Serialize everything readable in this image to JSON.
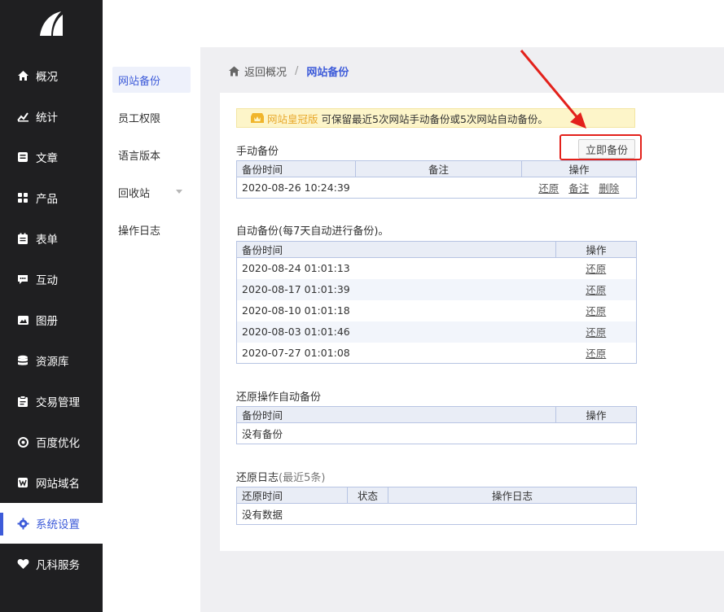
{
  "sidebar": {
    "items": [
      {
        "label": "概况",
        "icon": "home-icon"
      },
      {
        "label": "统计",
        "icon": "stats-icon"
      },
      {
        "label": "文章",
        "icon": "article-icon"
      },
      {
        "label": "产品",
        "icon": "product-icon"
      },
      {
        "label": "表单",
        "icon": "form-icon"
      },
      {
        "label": "互动",
        "icon": "chat-icon"
      },
      {
        "label": "图册",
        "icon": "gallery-icon"
      },
      {
        "label": "资源库",
        "icon": "database-icon"
      },
      {
        "label": "交易管理",
        "icon": "trade-icon"
      },
      {
        "label": "百度优化",
        "icon": "seo-icon"
      },
      {
        "label": "网站域名",
        "icon": "domain-icon"
      },
      {
        "label": "系统设置",
        "icon": "gear-icon"
      },
      {
        "label": "凡科服务",
        "icon": "heart-icon"
      }
    ]
  },
  "submenu": {
    "items": [
      "网站备份",
      "员工权限",
      "语言版本",
      "回收站",
      "操作日志"
    ]
  },
  "breadcrumb": {
    "back": "返回概况",
    "separator": "/",
    "current": "网站备份"
  },
  "notice": {
    "tag": "网站皇冠版",
    "text": "可保留最近5次网站手动备份或5次网站自动备份。"
  },
  "manual": {
    "title": "手动备份",
    "button": "立即备份",
    "headers": [
      "备份时间",
      "备注",
      "操作"
    ],
    "rows": [
      {
        "time": "2020-08-26 10:24:39",
        "note": "",
        "ops": [
          "还原",
          "备注",
          "删除"
        ]
      }
    ]
  },
  "auto": {
    "title": "自动备份(每7天自动进行备份)。",
    "headers": [
      "备份时间",
      "操作"
    ],
    "op": "还原",
    "rows": [
      "2020-08-24 01:01:13",
      "2020-08-17 01:01:39",
      "2020-08-10 01:01:18",
      "2020-08-03 01:01:46",
      "2020-07-27 01:01:08"
    ]
  },
  "restore_auto": {
    "title": "还原操作自动备份",
    "headers": [
      "备份时间",
      "操作"
    ],
    "empty": "没有备份"
  },
  "restore_log": {
    "title": "还原日志",
    "title_muted": "(最近5条)",
    "headers": [
      "还原时间",
      "状态",
      "操作日志"
    ],
    "empty": "没有数据"
  },
  "colors": {
    "accent": "#3d5bd9",
    "sidebar_bg": "#1f1f21",
    "highlight": "#e3211b",
    "notice_bg": "#fdf5c9"
  }
}
